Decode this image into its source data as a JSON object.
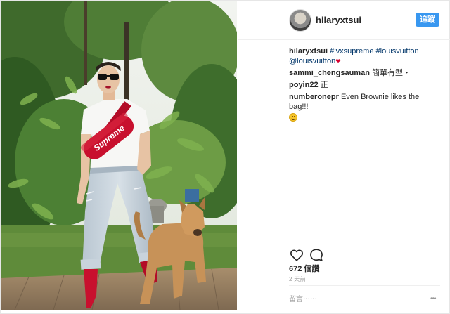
{
  "header": {
    "username": "hilaryxtsui",
    "follow_label": "追蹤"
  },
  "caption": {
    "user": "hilaryxtsui",
    "tags": [
      "#lvxsupreme",
      "#louisvuitton",
      "@louisvuitton"
    ]
  },
  "comments": [
    {
      "user": "sammi_chengsauman",
      "text": "簡單有型・"
    },
    {
      "user": "poyin22",
      "text": "正"
    },
    {
      "user": "numberonepr",
      "text": "Even Brownie likes the bag!!!"
    }
  ],
  "photo": {
    "bag_text": "Supreme"
  },
  "stats": {
    "likes": "672 個讚",
    "time": "2 天前"
  },
  "comment_box": {
    "placeholder": "留言⋯⋯",
    "more": "•••"
  },
  "icons": {
    "like": "heart-icon",
    "comment": "comment-bubble-icon",
    "more": "more-dots-icon"
  },
  "colors": {
    "follow_button": "#3897f0",
    "hashtag": "#003569",
    "bag_red": "#c8102e"
  }
}
